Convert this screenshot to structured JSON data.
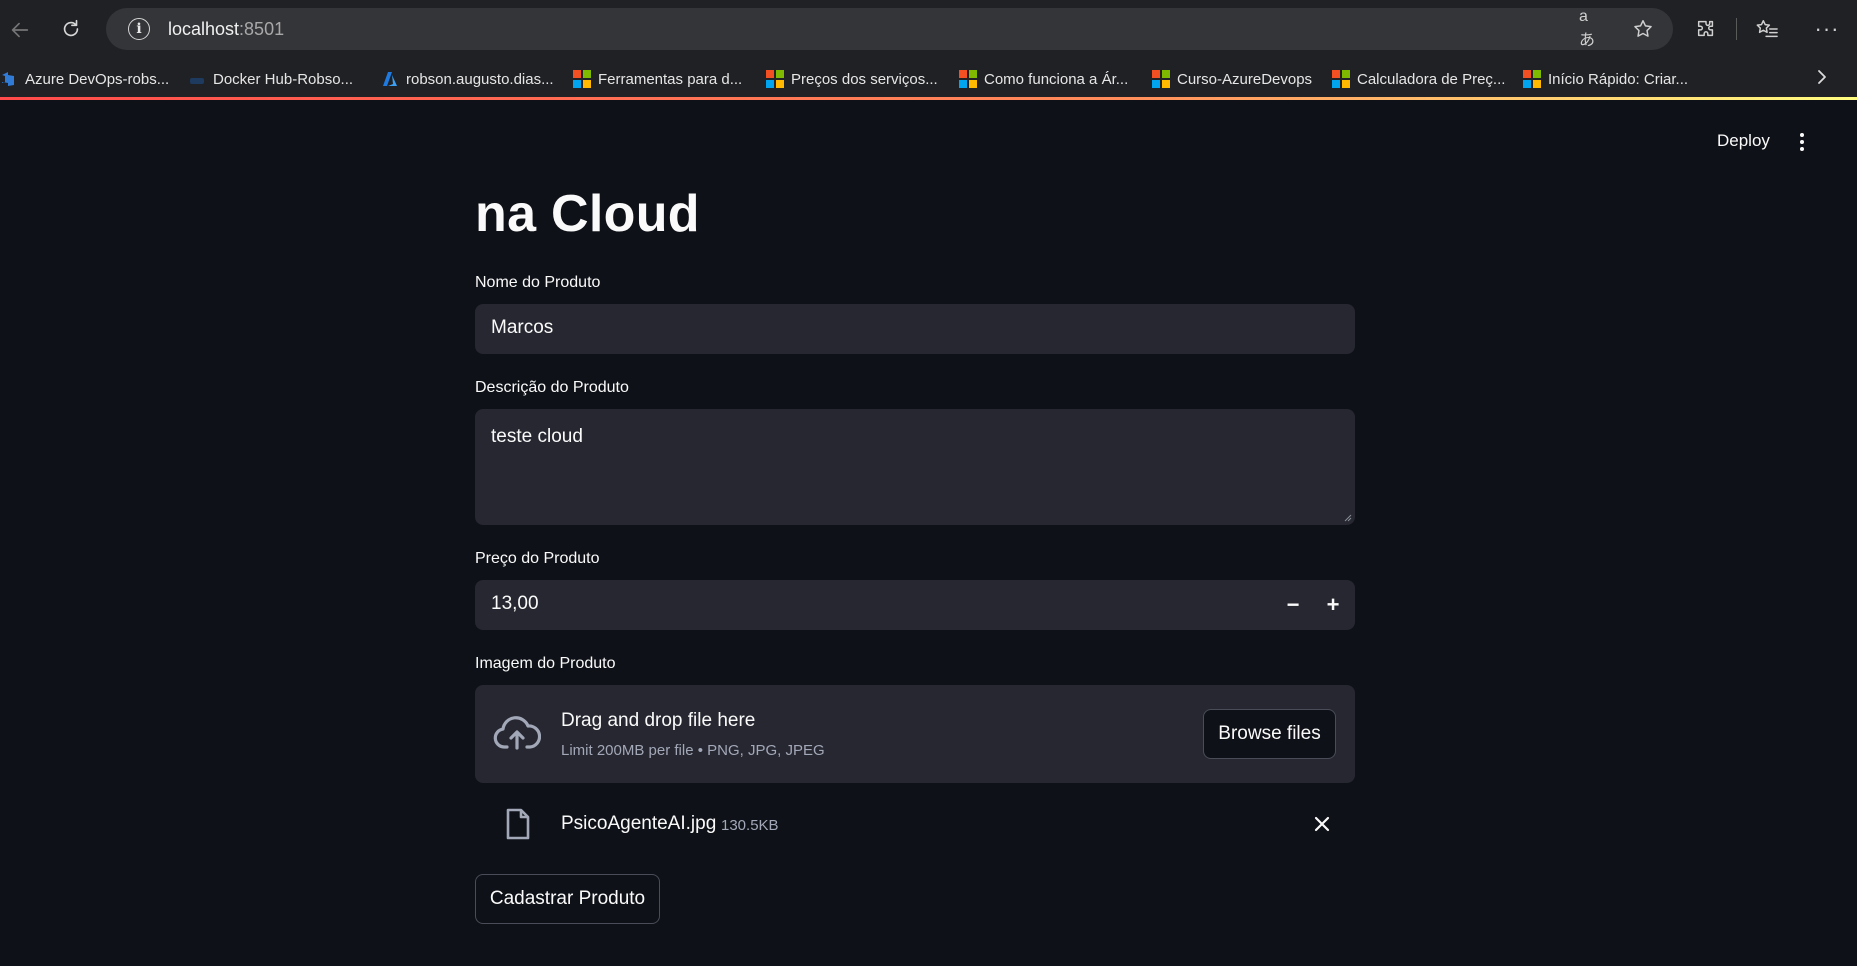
{
  "browser": {
    "url_host": "localhost",
    "url_port": ":8501",
    "bookmarks": [
      {
        "label": "Azure DevOps-robs...",
        "icon": "azure-devops-icon"
      },
      {
        "label": "Docker Hub-Robso...",
        "icon": "docker-icon"
      },
      {
        "label": "robson.augusto.dias...",
        "icon": "azure-icon"
      },
      {
        "label": "Ferramentas para d...",
        "icon": "microsoft-icon"
      },
      {
        "label": "Preços dos serviços...",
        "icon": "microsoft-icon"
      },
      {
        "label": "Como funciona a Ár...",
        "icon": "microsoft-icon"
      },
      {
        "label": "Curso-AzureDevops",
        "icon": "microsoft-icon"
      },
      {
        "label": "Calculadora de Preç...",
        "icon": "microsoft-icon"
      },
      {
        "label": "Início Rápido: Criar...",
        "icon": "microsoft-icon"
      }
    ]
  },
  "toolbar": {
    "deploy_label": "Deploy"
  },
  "page": {
    "title": "na Cloud"
  },
  "form": {
    "name_label": "Nome do Produto",
    "name_value": "Marcos",
    "description_label": "Descrição do Produto",
    "description_value": "teste cloud",
    "price_label": "Preço do Produto",
    "price_value": "13,00",
    "price_decrement": "−",
    "price_increment": "+",
    "image_label": "Imagem do Produto",
    "dropzone_title": "Drag and drop file here",
    "dropzone_hint": "Limit 200MB per file • PNG, JPG, JPEG",
    "browse_label": "Browse files",
    "uploaded_file": {
      "name": "PsicoAgenteAI.jpg",
      "size": "130.5KB"
    },
    "submit_label": "Cadastrar Produto"
  },
  "colors": {
    "background": "#0e1117",
    "input_bg": "#262730",
    "accent": "#ff4b4b",
    "muted_text": "#a3a8b8"
  }
}
